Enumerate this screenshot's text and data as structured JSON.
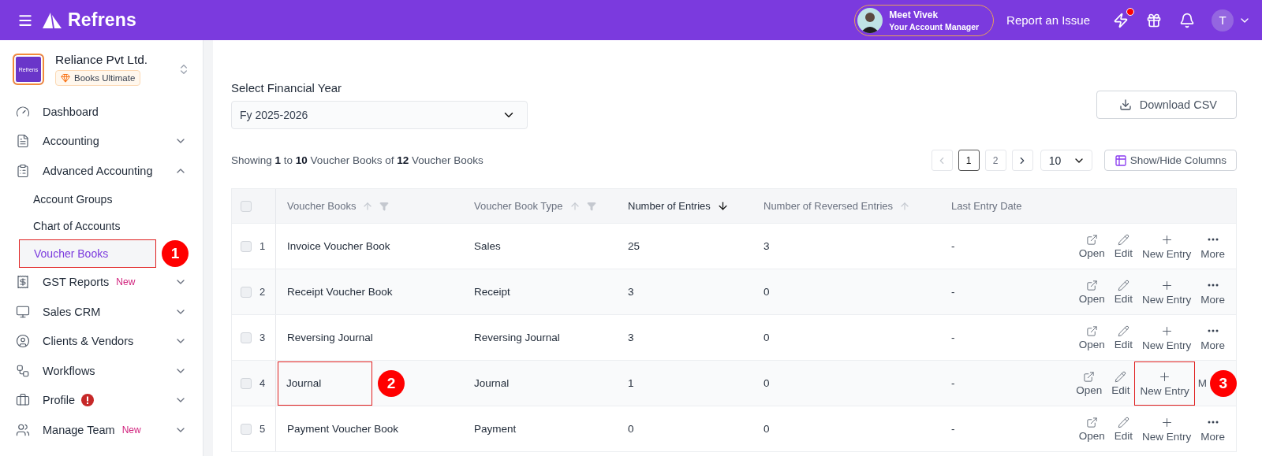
{
  "topbar": {
    "brand": "Refrens",
    "manager": {
      "name": "Meet Vivek",
      "role": "Your Account Manager"
    },
    "report_link": "Report an Issue",
    "notification_dot": true,
    "user_initial": "T"
  },
  "company": {
    "name": "Reliance Pvt Ltd.",
    "logo_text": "Refrens",
    "plan": "Books Ultimate"
  },
  "sidebar": {
    "items": [
      {
        "label": "Dashboard"
      },
      {
        "label": "Accounting",
        "expanded": false
      },
      {
        "label": "Advanced Accounting",
        "expanded": true,
        "children": [
          {
            "label": "Account Groups",
            "selected": false
          },
          {
            "label": "Chart of Accounts",
            "selected": false
          },
          {
            "label": "Voucher Books",
            "selected": true,
            "annotation": "1"
          }
        ]
      },
      {
        "label": "GST Reports",
        "badge": "New",
        "expanded": false
      },
      {
        "label": "Sales CRM",
        "expanded": false
      },
      {
        "label": "Clients & Vendors",
        "expanded": false
      },
      {
        "label": "Workflows",
        "expanded": false
      },
      {
        "label": "Profile",
        "alert": true,
        "expanded": false
      },
      {
        "label": "Manage Team",
        "badge": "New",
        "expanded": false
      }
    ]
  },
  "filters": {
    "label": "Select Financial Year",
    "value": "Fy 2025-2026"
  },
  "download_button": "Download CSV",
  "summary": "Showing **1** to **10** Voucher Books of **12** Voucher Books",
  "pagination": {
    "pages": [
      {
        "label": "1",
        "selected": true
      },
      {
        "label": "2",
        "selected": false
      }
    ],
    "page_size": "10"
  },
  "columns_button": "Show/Hide Columns",
  "table": {
    "select_all_checked": false,
    "columns": [
      {
        "label": "Voucher Books",
        "sortable": true,
        "sorted": false,
        "filter": true
      },
      {
        "label": "Voucher Book Type",
        "sortable": true,
        "sorted": false,
        "filter": true
      },
      {
        "label": "Number of Entries",
        "sortable": true,
        "sorted": true,
        "filter": false
      },
      {
        "label": "Number of Reversed Entries",
        "sortable": true,
        "sorted": false,
        "filter": false
      },
      {
        "label": "Last Entry Date",
        "sortable": false,
        "sorted": false,
        "filter": false
      }
    ],
    "rows": [
      {
        "checked": false,
        "index": "1",
        "name": "Invoice Voucher Book",
        "type": "Sales",
        "entries": "25",
        "reversed": "3",
        "last_date": "-",
        "actions": [
          {
            "kind": "open",
            "label": "Open"
          },
          {
            "kind": "edit",
            "label": "Edit"
          },
          {
            "kind": "new",
            "label": "New Entry"
          },
          {
            "kind": "more",
            "label": "More"
          }
        ]
      },
      {
        "checked": false,
        "index": "2",
        "name": "Receipt Voucher Book",
        "type": "Receipt",
        "entries": "3",
        "reversed": "0",
        "last_date": "-",
        "actions": [
          {
            "kind": "open",
            "label": "Open"
          },
          {
            "kind": "edit",
            "label": "Edit"
          },
          {
            "kind": "new",
            "label": "New Entry"
          },
          {
            "kind": "more",
            "label": "More"
          }
        ]
      },
      {
        "checked": false,
        "index": "3",
        "name": "Reversing Journal",
        "type": "Reversing Journal",
        "entries": "3",
        "reversed": "0",
        "last_date": "-",
        "actions": [
          {
            "kind": "open",
            "label": "Open"
          },
          {
            "kind": "edit",
            "label": "Edit"
          },
          {
            "kind": "new",
            "label": "New Entry"
          },
          {
            "kind": "more",
            "label": "More"
          }
        ]
      },
      {
        "checked": false,
        "index": "4",
        "name": "Journal",
        "name_annotation": "2",
        "type": "Journal",
        "entries": "1",
        "reversed": "0",
        "last_date": "-",
        "actions": [
          {
            "kind": "open",
            "label": "Open"
          },
          {
            "kind": "edit",
            "label": "Edit"
          },
          {
            "kind": "new",
            "label": "New Entry",
            "annotation": "3"
          },
          {
            "kind": "covered",
            "label": "M"
          }
        ]
      },
      {
        "checked": false,
        "index": "5",
        "name": "Payment Voucher Book",
        "type": "Payment",
        "entries": "0",
        "reversed": "0",
        "last_date": "-",
        "actions": [
          {
            "kind": "open",
            "label": "Open"
          },
          {
            "kind": "edit",
            "label": "Edit"
          },
          {
            "kind": "new",
            "label": "New Entry"
          },
          {
            "kind": "more",
            "label": "More"
          }
        ]
      }
    ]
  }
}
